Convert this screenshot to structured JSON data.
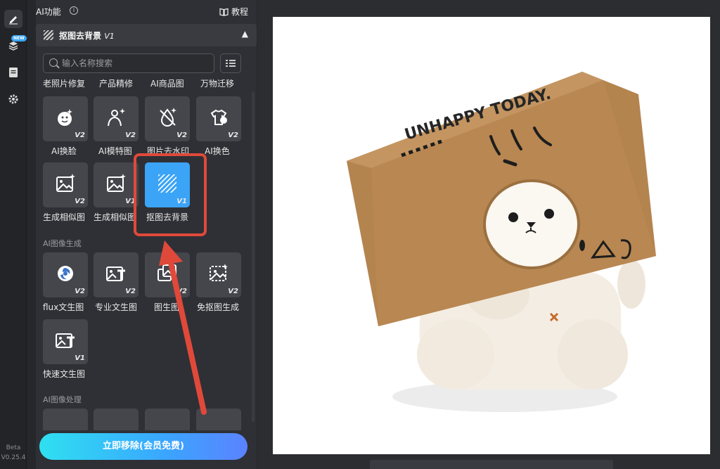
{
  "rail": {
    "items": [
      {
        "icon": "edit-icon"
      },
      {
        "icon": "layers-icon",
        "badge": "NEW"
      },
      {
        "icon": "document-icon"
      },
      {
        "icon": "gear-icon"
      }
    ],
    "beta_label": "Beta",
    "version": "V0.25.4"
  },
  "panel": {
    "title": "AI功能",
    "tutorial_label": "教程",
    "section_title": "抠图去背景",
    "section_version": "V1",
    "search_placeholder": "输入名称搜索",
    "top_labels": [
      "老照片修复",
      "产品精修",
      "AI商品图",
      "万物迁移"
    ],
    "row1": [
      {
        "label": "AI换脸",
        "version": "V2",
        "icon": "face-swap-icon"
      },
      {
        "label": "AI模特图",
        "version": "V2",
        "icon": "model-icon"
      },
      {
        "label": "图片去水印",
        "version": "V2",
        "icon": "remove-watermark-icon"
      },
      {
        "label": "AI换色",
        "version": "V2",
        "icon": "recolor-icon"
      }
    ],
    "row2": [
      {
        "label": "生成相似图",
        "version": "V2",
        "icon": "image-sparkle-icon"
      },
      {
        "label": "生成相似图",
        "version": "V1",
        "icon": "image-sparkle-icon"
      },
      {
        "label": "抠图去背景",
        "version": "V1",
        "icon": "cutout-icon",
        "active": true
      }
    ],
    "gen_heading": "AI图像生成",
    "row3": [
      {
        "label": "flux文生图",
        "version": "V2",
        "icon": "flux-icon"
      },
      {
        "label": "专业文生图",
        "version": "V2",
        "icon": "text-to-image-icon"
      },
      {
        "label": "图生图",
        "version": "V2",
        "icon": "image-to-image-icon"
      },
      {
        "label": "免抠图生成",
        "version": "V2",
        "icon": "cutout-generate-icon"
      }
    ],
    "row4": [
      {
        "label": "快速文生图",
        "version": "V1",
        "icon": "text-to-image-icon"
      }
    ],
    "proc_heading": "AI图像处理",
    "cta_label": "立即移除(会员免费)"
  },
  "canvas": {
    "box_text": "UNHAPPY TODAY.",
    "highlight_color": "#e0493a",
    "accent": "#3ba4f7"
  }
}
